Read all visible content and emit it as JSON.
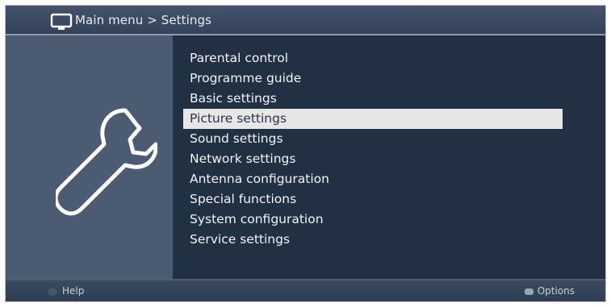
{
  "header": {
    "title": "Main menu > Settings",
    "icon": "tv-icon"
  },
  "sidebar": {
    "icon": "wrench-icon"
  },
  "menu": {
    "items": [
      {
        "label": "Parental control",
        "selected": false
      },
      {
        "label": "Programme guide",
        "selected": false
      },
      {
        "label": "Basic settings",
        "selected": false
      },
      {
        "label": "Picture settings",
        "selected": true
      },
      {
        "label": "Sound settings",
        "selected": false
      },
      {
        "label": "Network settings",
        "selected": false
      },
      {
        "label": "Antenna configuration",
        "selected": false
      },
      {
        "label": "Special functions",
        "selected": false
      },
      {
        "label": "System configuration",
        "selected": false
      },
      {
        "label": "Service settings",
        "selected": false
      }
    ]
  },
  "footer": {
    "help_label": "Help",
    "options_label": "Options"
  },
  "colors": {
    "background": "#2c3a50",
    "left_panel": "#4a5b72",
    "right_panel": "#223044",
    "selection": "#e6e6e6"
  }
}
